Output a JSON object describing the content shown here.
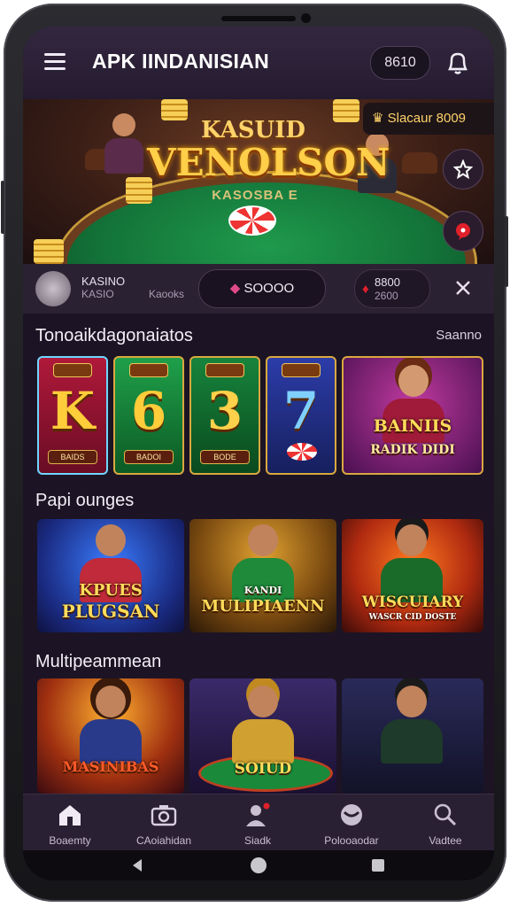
{
  "header": {
    "title": "APK IINDANISIAN",
    "balance": "8610"
  },
  "banner": {
    "logo_line1": "KASUID",
    "logo_line2": "VENOLSON",
    "table_text": "KASOSBA E",
    "badge": "Slacaur 8009"
  },
  "info_strip": {
    "user_name": "KASINO",
    "user_sub": "KASIO",
    "user_sub2": "Kaooks",
    "bet_label": "SOOOO",
    "right_value": "8800",
    "right_sub": "2600"
  },
  "section1": {
    "title": "Tonoaikdagonaiatos",
    "link": "Saanno",
    "tiles": [
      {
        "symbol": "K",
        "caption": "BAIDS"
      },
      {
        "symbol": "6",
        "caption": "BADOI"
      },
      {
        "symbol": "3",
        "caption": "BODE"
      },
      {
        "symbol": "7",
        "caption": ""
      },
      {
        "caption_line1": "BAINIIS",
        "caption_line2": "RADIK DIDI"
      }
    ]
  },
  "section2": {
    "title": "Papi ounges",
    "tiles": [
      {
        "caption_line1": "KPUES",
        "caption_line2": "PLUGSAN"
      },
      {
        "caption_line1": "KANDI",
        "caption_line2": "MULIPIAENN"
      },
      {
        "caption_line1": "WISCUIARY",
        "caption_line2": "WASCR CID DOSTE"
      }
    ]
  },
  "section3": {
    "title": "Multipeammean",
    "tiles": [
      {
        "caption": "MASINIBAS"
      },
      {
        "caption": "SOIUD"
      },
      {
        "caption": ""
      }
    ]
  },
  "bottom_nav": [
    {
      "label": "Boaemty",
      "icon": "home-icon"
    },
    {
      "label": "CAoiahidan",
      "icon": "camera-icon"
    },
    {
      "label": "Siadk",
      "icon": "user-alert-icon"
    },
    {
      "label": "Polooaodar",
      "icon": "globe-icon"
    },
    {
      "label": "Vadtee",
      "icon": "search-icon"
    }
  ],
  "colors": {
    "background": "#1c1424",
    "topbar": "#2a1f34",
    "accent_gold": "#ffcf4a",
    "nav": "#2a2033"
  }
}
